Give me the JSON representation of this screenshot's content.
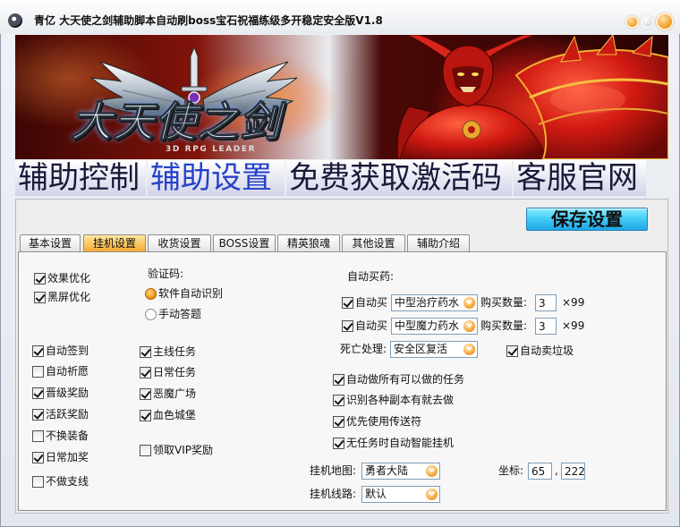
{
  "window": {
    "title": "青亿 大天使之剑辅助脚本自动刷boss宝石祝福练级多开稳定安全版V1.8",
    "icons": {
      "app": "app-icon",
      "minimize": "minimize-icon",
      "maximize": "maximize-icon",
      "close": "close-icon",
      "dropdown": "chevron-down-icon"
    }
  },
  "banner": {
    "logo": "大天使之剑",
    "tagline": "3D RPG LEADER"
  },
  "menu": [
    {
      "label": "辅助控制",
      "active": false
    },
    {
      "label": "辅助设置",
      "active": true
    },
    {
      "label": "免费获取激活码",
      "active": false
    },
    {
      "label": "客服官网",
      "active": false
    }
  ],
  "save_button": {
    "label": "保存设置"
  },
  "tabs": [
    {
      "label": "基本设置",
      "active": false
    },
    {
      "label": "挂机设置",
      "active": true
    },
    {
      "label": "收货设置",
      "active": false
    },
    {
      "label": "BOSS设置",
      "active": false
    },
    {
      "label": "精英狼魂",
      "active": false
    },
    {
      "label": "其他设置",
      "active": false
    },
    {
      "label": "辅助介绍",
      "active": false
    }
  ],
  "hangup": {
    "effect_opt": {
      "label": "效果优化",
      "checked": true
    },
    "black_screen": {
      "label": "黑屏优化",
      "checked": true
    },
    "captcha": {
      "label": "验证码:",
      "options": [
        {
          "label": "软件自动识别",
          "selected": true
        },
        {
          "label": "手动答题",
          "selected": false
        }
      ]
    },
    "potions": {
      "label": "自动买药:",
      "rows": [
        {
          "check_label": "自动买",
          "checked": true,
          "item": "中型治疗药水",
          "qty_label": "购买数量:",
          "qty": "3",
          "unit": "×99"
        },
        {
          "check_label": "自动买",
          "checked": true,
          "item": "中型魔力药水",
          "qty_label": "购买数量:",
          "qty": "3",
          "unit": "×99"
        }
      ]
    },
    "death": {
      "label": "死亡处理:",
      "value": "安全区复活"
    },
    "auto_sell": {
      "label": "自动卖垃圾",
      "checked": true
    },
    "rewards": [
      {
        "label": "自动签到",
        "checked": true
      },
      {
        "label": "自动祈愿",
        "checked": false
      },
      {
        "label": "晋级奖励",
        "checked": true
      },
      {
        "label": "活跃奖励",
        "checked": true
      },
      {
        "label": "不换装备",
        "checked": false
      },
      {
        "label": "日常加奖",
        "checked": true
      },
      {
        "label": "不做支线",
        "checked": false
      }
    ],
    "quests": [
      {
        "label": "主线任务",
        "checked": true
      },
      {
        "label": "日常任务",
        "checked": true
      },
      {
        "label": "恶魔广场",
        "checked": true
      },
      {
        "label": "血色城堡",
        "checked": true
      }
    ],
    "vip": {
      "label": "领取VIP奖励",
      "checked": false
    },
    "tasks": [
      {
        "label": "自动做所有可以做的任务",
        "checked": true
      },
      {
        "label": "识别各种副本有就去做",
        "checked": true
      },
      {
        "label": "优先使用传送符",
        "checked": true
      },
      {
        "label": "无任务时自动智能挂机",
        "checked": true
      }
    ],
    "map": {
      "label": "挂机地图:",
      "value": "勇者大陆"
    },
    "coords": {
      "label": "坐标:",
      "x": "65",
      "separator": ",",
      "y": "222"
    },
    "line": {
      "label": "挂机线路:",
      "value": "默认"
    }
  },
  "colors": {
    "accent_orange": "#f39a1e",
    "menu_active": "#2442c8",
    "save_button": "#29b6ee",
    "tab_active": "#f5a62a",
    "banner_red": "#b8160f"
  }
}
